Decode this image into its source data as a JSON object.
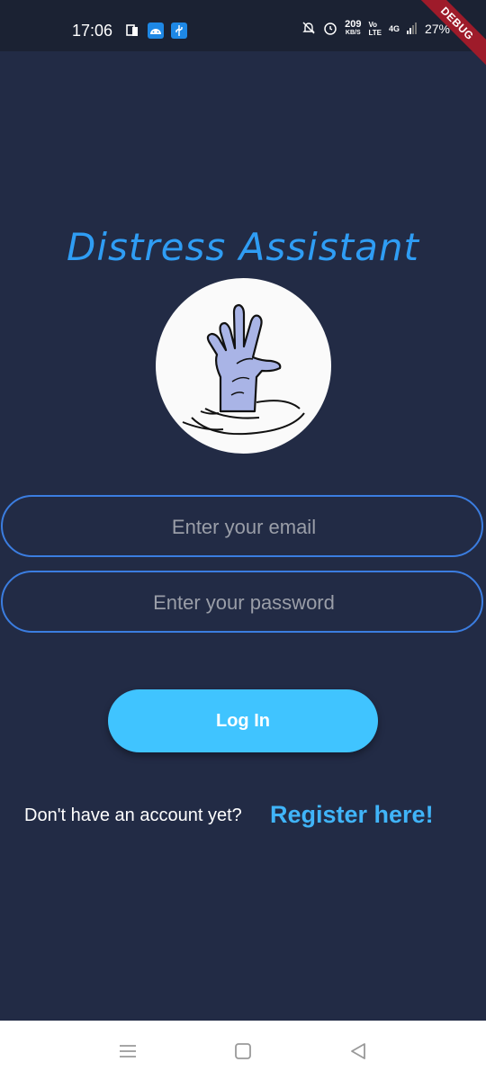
{
  "status_bar": {
    "time": "17:06",
    "speed_value": "209",
    "speed_unit": "KB/S",
    "volte_top": "Vo",
    "volte_bottom": "LTE",
    "network": "4G",
    "battery": "27%",
    "left_icons": [
      "phone-flip-icon",
      "android-icon",
      "usb-icon"
    ],
    "right_icons": [
      "mute-bell-icon",
      "alarm-icon",
      "signal-icon"
    ]
  },
  "debug_banner": "DEBUG",
  "app": {
    "title": "Distress Assistant",
    "logo": "drowning-hand-icon"
  },
  "form": {
    "email_placeholder": "Enter your email",
    "email_value": "",
    "password_placeholder": "Enter your password",
    "password_value": "",
    "login_label": "Log In"
  },
  "register": {
    "prompt": "Don't have an account yet?",
    "link_label": "Register here!"
  },
  "colors": {
    "background": "#222b45",
    "accent": "#40c4ff",
    "title": "#2f9df4",
    "field_border": "#3b7de0",
    "debug": "#9e1b2a"
  },
  "nav_bar": {
    "buttons": [
      "menu-icon",
      "home-icon",
      "back-icon"
    ]
  }
}
